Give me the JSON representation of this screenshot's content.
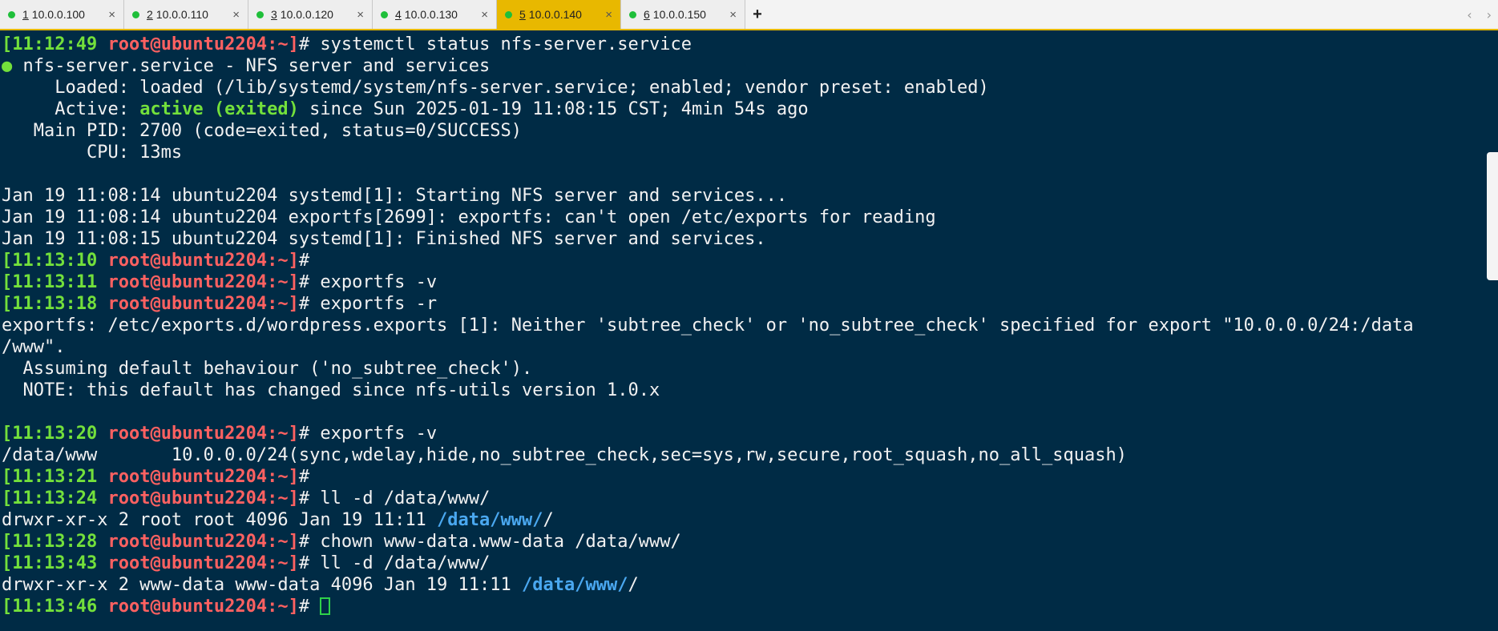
{
  "tabs": [
    {
      "num": "1",
      "host": "10.0.0.100",
      "close": "×"
    },
    {
      "num": "2",
      "host": "10.0.0.110",
      "close": "×"
    },
    {
      "num": "3",
      "host": "10.0.0.120",
      "close": "×"
    },
    {
      "num": "4",
      "host": "10.0.0.130",
      "close": "×"
    },
    {
      "num": "5",
      "host": "10.0.0.140",
      "close": "×"
    },
    {
      "num": "6",
      "host": "10.0.0.150",
      "close": "×"
    }
  ],
  "new_tab": "+",
  "nav": {
    "left": "‹",
    "right": "›"
  },
  "colors": {
    "accent": "#e8b800",
    "background": "#002b45",
    "prompt_time": "#73e03b",
    "prompt_user": "#ff6161",
    "path": "#4aa8f0"
  },
  "terminal": {
    "p1": {
      "time": "[11:12:49",
      "user": "root@ubuntu2204:~]",
      "sym": "# ",
      "cmd": "systemctl status nfs-server.service"
    },
    "svc_dot": "●",
    "svc_title": " nfs-server.service - NFS server and services",
    "loaded": "     Loaded: loaded (/lib/systemd/system/nfs-server.service; enabled; vendor preset: enabled)",
    "active_label": "     Active: ",
    "active_value": "active (exited)",
    "active_rest": " since Sun 2025-01-19 11:08:15 CST; 4min 54s ago",
    "main_pid": "   Main PID: 2700 (code=exited, status=0/SUCCESS)",
    "cpu": "        CPU: 13ms",
    "log1": "Jan 19 11:08:14 ubuntu2204 systemd[1]: Starting NFS server and services...",
    "log2": "Jan 19 11:08:14 ubuntu2204 exportfs[2699]: exportfs: can't open /etc/exports for reading",
    "log3": "Jan 19 11:08:15 ubuntu2204 systemd[1]: Finished NFS server and services.",
    "p2": {
      "time": "[11:13:10",
      "user": "root@ubuntu2204:~]",
      "sym": "#",
      "cmd": ""
    },
    "p3": {
      "time": "[11:13:11",
      "user": "root@ubuntu2204:~]",
      "sym": "# ",
      "cmd": "exportfs -v"
    },
    "p4": {
      "time": "[11:13:18",
      "user": "root@ubuntu2204:~]",
      "sym": "# ",
      "cmd": "exportfs -r"
    },
    "warn1": "exportfs: /etc/exports.d/wordpress.exports [1]: Neither 'subtree_check' or 'no_subtree_check' specified for export \"10.0.0.0/24:/data",
    "warn2": "/www\".",
    "warn3": "  Assuming default behaviour ('no_subtree_check').",
    "warn4": "  NOTE: this default has changed since nfs-utils version 1.0.x",
    "p5": {
      "time": "[11:13:20",
      "user": "root@ubuntu2204:~]",
      "sym": "# ",
      "cmd": "exportfs -v"
    },
    "export_line": "/data/www       10.0.0.0/24(sync,wdelay,hide,no_subtree_check,sec=sys,rw,secure,root_squash,no_all_squash)",
    "p6": {
      "time": "[11:13:21",
      "user": "root@ubuntu2204:~]",
      "sym": "#",
      "cmd": ""
    },
    "p7": {
      "time": "[11:13:24",
      "user": "root@ubuntu2204:~]",
      "sym": "# ",
      "cmd": "ll -d /data/www/"
    },
    "ll1_prefix": "drwxr-xr-x 2 root root 4096 Jan 19 11:11 ",
    "ll1_dir": "/data/www/",
    "ll1_suffix": "/",
    "p8": {
      "time": "[11:13:28",
      "user": "root@ubuntu2204:~]",
      "sym": "# ",
      "cmd": "chown www-data.www-data /data/www/"
    },
    "p9": {
      "time": "[11:13:43",
      "user": "root@ubuntu2204:~]",
      "sym": "# ",
      "cmd": "ll -d /data/www/"
    },
    "ll2_prefix": "drwxr-xr-x 2 www-data www-data 4096 Jan 19 11:11 ",
    "ll2_dir": "/data/www/",
    "ll2_suffix": "/",
    "p10": {
      "time": "[11:13:46",
      "user": "root@ubuntu2204:~]",
      "sym": "# ",
      "cmd": ""
    }
  }
}
